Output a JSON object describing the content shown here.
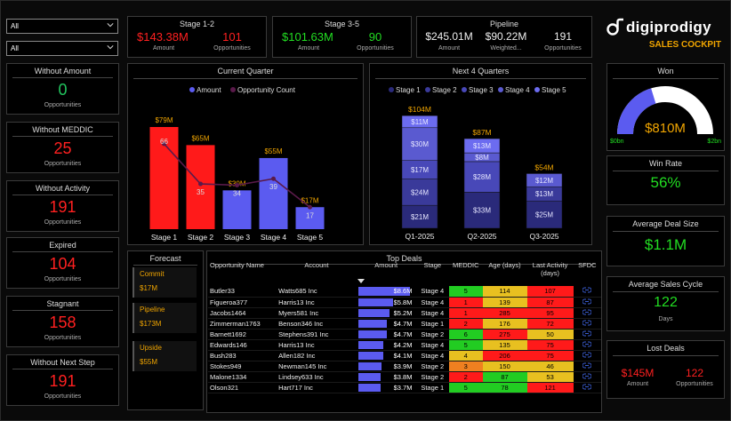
{
  "filters": {
    "filter1": "All",
    "filter2": "All"
  },
  "brand": {
    "logo_text": "digiprodigy",
    "subtitle": "SALES COCKPIT"
  },
  "stage12": {
    "title": "Stage 1-2",
    "amount": "$143.38M",
    "amount_label": "Amount",
    "opps": "101",
    "opps_label": "Opportunities"
  },
  "stage35": {
    "title": "Stage 3-5",
    "amount": "$101.63M",
    "amount_label": "Amount",
    "opps": "90",
    "opps_label": "Opportunities"
  },
  "pipeline": {
    "title": "Pipeline",
    "amount": "$245.01M",
    "amount_label": "Amount",
    "weighted": "$90.22M",
    "weighted_label": "Weighted...",
    "opps": "191",
    "opps_label": "Opportunities"
  },
  "kpis": [
    {
      "title": "Without Amount",
      "value": "0",
      "sub": "Opportunities",
      "color": "#22c55e"
    },
    {
      "title": "Without MEDDIC",
      "value": "25",
      "sub": "Opportunities",
      "color": "#ff2020"
    },
    {
      "title": "Without Activity",
      "value": "191",
      "sub": "Opportunities",
      "color": "#ff2020"
    },
    {
      "title": "Expired",
      "value": "104",
      "sub": "Opportunities",
      "color": "#ff2020"
    },
    {
      "title": "Stagnant",
      "value": "158",
      "sub": "Opportunities",
      "color": "#ff2020"
    },
    {
      "title": "Without Next Step",
      "value": "191",
      "sub": "Opportunities",
      "color": "#ff2020"
    }
  ],
  "colors": {
    "red": "#ff1a1a",
    "blue": "#5b5bf0",
    "green": "#22dd22",
    "gold": "#f0a500",
    "line": "#5a1a4a"
  },
  "chart_data": [
    {
      "type": "bar",
      "title": "Current Quarter",
      "legend": [
        "Amount",
        "Opportunity Count"
      ],
      "categories": [
        "Stage 1",
        "Stage 2",
        "Stage 3",
        "Stage 4",
        "Stage 5"
      ],
      "series": [
        {
          "name": "Amount",
          "values": [
            79,
            65,
            30,
            55,
            17
          ],
          "labels": [
            "$79M",
            "$65M",
            "$30M",
            "$55M",
            "$17M"
          ]
        },
        {
          "name": "Opportunity Count",
          "values": [
            66,
            35,
            34,
            39,
            17
          ]
        }
      ]
    },
    {
      "type": "bar",
      "title": "Next 4 Quarters",
      "legend": [
        "Stage 1",
        "Stage 2",
        "Stage 3",
        "Stage 4",
        "Stage 5"
      ],
      "categories": [
        "Q1-2025",
        "Q2-2025",
        "Q3-2025"
      ],
      "totals": [
        "$104M",
        "$87M",
        "$54M"
      ],
      "segments": [
        [
          {
            "stage": 1,
            "value": 21,
            "label": "$21M"
          },
          {
            "stage": 2,
            "value": 24,
            "label": "$24M"
          },
          {
            "stage": 3,
            "value": 17,
            "label": "$17M"
          },
          {
            "stage": 4,
            "value": 30,
            "label": "$30M"
          },
          {
            "stage": 5,
            "value": 11,
            "label": "$11M"
          }
        ],
        [
          {
            "stage": 1,
            "value": 33,
            "label": "$33M"
          },
          {
            "stage": 3,
            "value": 28,
            "label": "$28M"
          },
          {
            "stage": 4,
            "value": 8,
            "label": "$8M"
          },
          {
            "stage": 5,
            "value": 13,
            "label": "$13M"
          }
        ],
        [
          {
            "stage": 1,
            "value": 25,
            "label": "$25M"
          },
          {
            "stage": 2,
            "value": 13,
            "label": "$13M"
          },
          {
            "stage": 4,
            "value": 12,
            "label": "$12M"
          }
        ]
      ]
    },
    {
      "type": "gauge",
      "title": "Won",
      "value": 810,
      "min": 0,
      "max": 2000,
      "value_label": "$810M",
      "min_label": "$0bn",
      "max_label": "$2bn"
    }
  ],
  "forecast": {
    "title": "Forecast",
    "items": [
      {
        "label": "Commit",
        "value": "$17M"
      },
      {
        "label": "Pipeline",
        "value": "$173M"
      },
      {
        "label": "Upside",
        "value": "$55M"
      }
    ]
  },
  "top_deals": {
    "title": "Top Deals",
    "headers": [
      "Opportunity Name",
      "Account",
      "Amount",
      "Stage",
      "MEDDIC",
      "Age (days)",
      "Last Activity (days)",
      "SFDC"
    ],
    "rows": [
      {
        "name": "Butler33",
        "account": "Watts685 Inc",
        "amount": "$8.6M",
        "amount_frac": 1.0,
        "stage": "Stage 4",
        "meddic": "5",
        "meddic_color": "#22cc22",
        "age": "114",
        "age_color": "#e8c020",
        "last": "107",
        "last_color": "#ff1a1a"
      },
      {
        "name": "Figueroa377",
        "account": "Harris13 Inc",
        "amount": "$5.8M",
        "amount_frac": 0.67,
        "stage": "Stage 4",
        "meddic": "1",
        "meddic_color": "#ff1a1a",
        "age": "139",
        "age_color": "#e8c020",
        "last": "87",
        "last_color": "#ff1a1a"
      },
      {
        "name": "Jacobs1464",
        "account": "Myers581 Inc",
        "amount": "$5.2M",
        "amount_frac": 0.6,
        "stage": "Stage 4",
        "meddic": "1",
        "meddic_color": "#ff1a1a",
        "age": "285",
        "age_color": "#ff1a1a",
        "last": "95",
        "last_color": "#ff1a1a"
      },
      {
        "name": "Zimmerman1763",
        "account": "Benson346 Inc",
        "amount": "$4.7M",
        "amount_frac": 0.55,
        "stage": "Stage 1",
        "meddic": "2",
        "meddic_color": "#ff1a1a",
        "age": "176",
        "age_color": "#e8c020",
        "last": "72",
        "last_color": "#ff1a1a"
      },
      {
        "name": "Barnett1692",
        "account": "Stephens391 Inc",
        "amount": "$4.7M",
        "amount_frac": 0.55,
        "stage": "Stage 2",
        "meddic": "6",
        "meddic_color": "#22cc22",
        "age": "275",
        "age_color": "#ff1a1a",
        "last": "50",
        "last_color": "#e8c020"
      },
      {
        "name": "Edwards146",
        "account": "Harris13 Inc",
        "amount": "$4.2M",
        "amount_frac": 0.49,
        "stage": "Stage 4",
        "meddic": "5",
        "meddic_color": "#22cc22",
        "age": "135",
        "age_color": "#e8c020",
        "last": "75",
        "last_color": "#ff1a1a"
      },
      {
        "name": "Bush283",
        "account": "Allen182 Inc",
        "amount": "$4.1M",
        "amount_frac": 0.48,
        "stage": "Stage 4",
        "meddic": "4",
        "meddic_color": "#e8c020",
        "age": "206",
        "age_color": "#ff1a1a",
        "last": "75",
        "last_color": "#ff1a1a"
      },
      {
        "name": "Stokes949",
        "account": "Newman145 Inc",
        "amount": "$3.9M",
        "amount_frac": 0.45,
        "stage": "Stage 2",
        "meddic": "3",
        "meddic_color": "#f08020",
        "age": "150",
        "age_color": "#e8c020",
        "last": "46",
        "last_color": "#e8c020"
      },
      {
        "name": "Malone1334",
        "account": "Lindsey633 Inc",
        "amount": "$3.8M",
        "amount_frac": 0.44,
        "stage": "Stage 2",
        "meddic": "2",
        "meddic_color": "#ff1a1a",
        "age": "87",
        "age_color": "#22cc22",
        "last": "53",
        "last_color": "#e8c020"
      },
      {
        "name": "Olson321",
        "account": "Hart717 Inc",
        "amount": "$3.7M",
        "amount_frac": 0.43,
        "stage": "Stage 1",
        "meddic": "5",
        "meddic_color": "#22cc22",
        "age": "78",
        "age_color": "#22cc22",
        "last": "121",
        "last_color": "#ff1a1a"
      }
    ]
  },
  "win_rate": {
    "title": "Win Rate",
    "value": "56%"
  },
  "avg_deal": {
    "title": "Average Deal Size",
    "value": "$1.1M"
  },
  "avg_cycle": {
    "title": "Average Sales Cycle",
    "value": "122",
    "sub": "Days"
  },
  "lost": {
    "title": "Lost Deals",
    "amount": "$145M",
    "amount_label": "Amount",
    "opps": "122",
    "opps_label": "Opportunities"
  }
}
